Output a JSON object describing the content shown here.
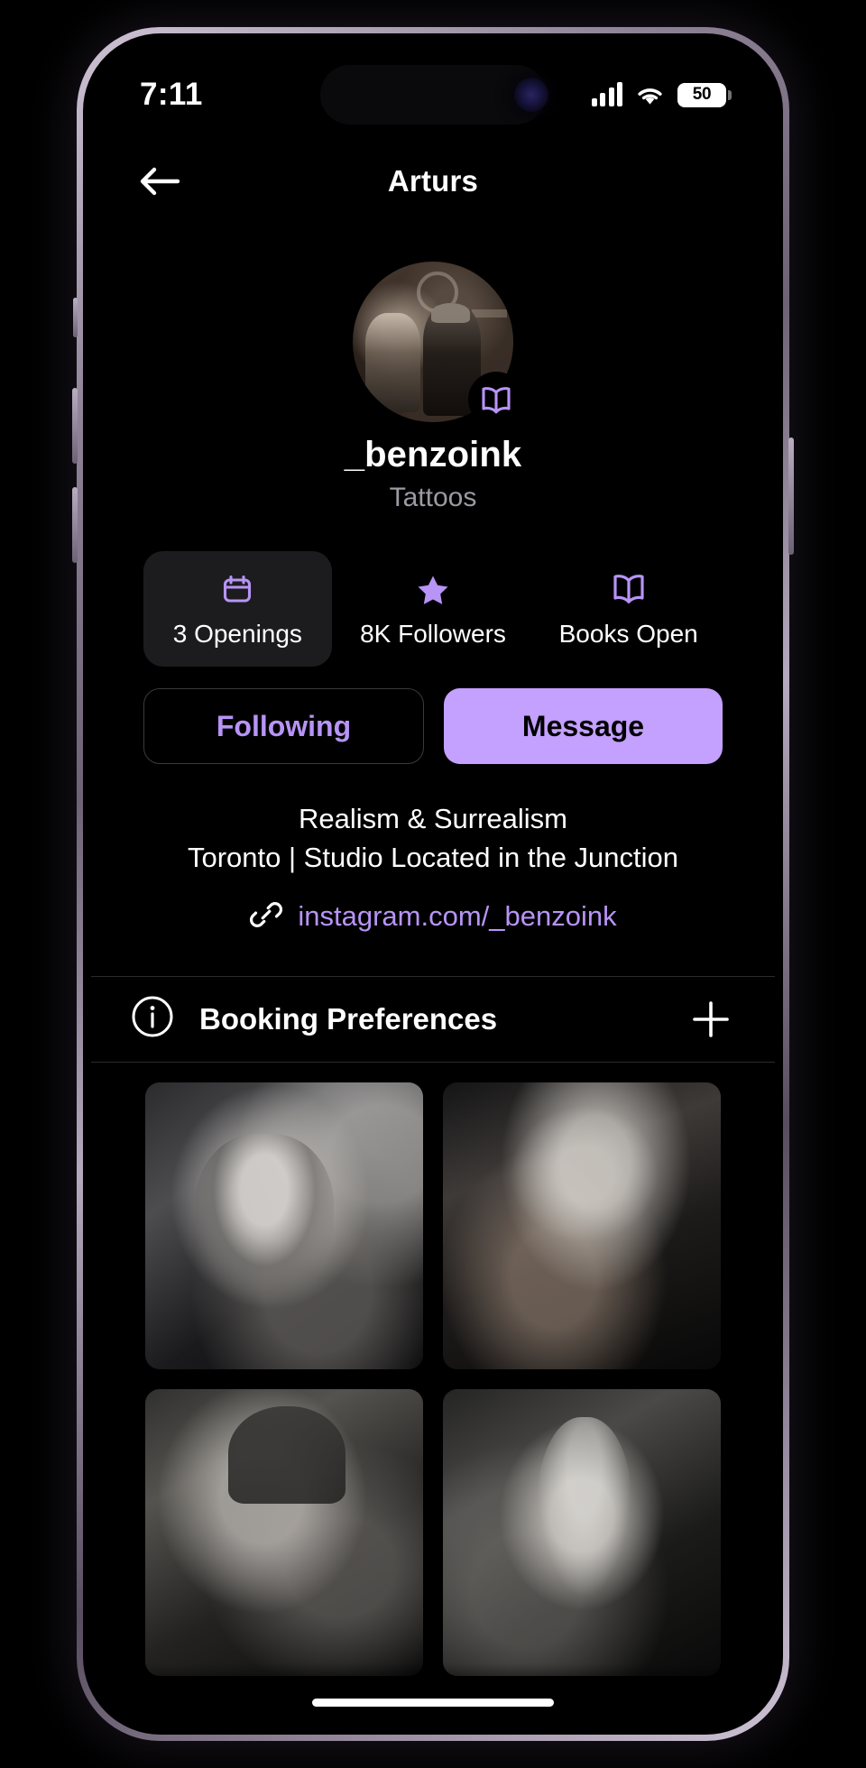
{
  "status_bar": {
    "time": "7:11",
    "battery_level": "50",
    "signal_icon": "cellular-signal-icon",
    "wifi_icon": "wifi-icon",
    "battery_icon": "battery-icon"
  },
  "nav": {
    "title": "Arturs",
    "back_icon": "arrow-left-icon"
  },
  "profile": {
    "name": "_benzoink",
    "subtitle": "Tattoos",
    "avatar_alt": "tattoo-artist-at-work-photo",
    "badge_icon": "open-book-icon"
  },
  "stats": [
    {
      "label": "3 Openings",
      "icon": "calendar-icon",
      "active": true
    },
    {
      "label": "8K Followers",
      "icon": "star-icon",
      "active": false
    },
    {
      "label": "Books Open",
      "icon": "open-book-icon",
      "active": false
    }
  ],
  "actions": {
    "following_label": "Following",
    "message_label": "Message"
  },
  "bio": {
    "line1": "Realism & Surrealism",
    "line2": "Toronto | Studio Located in the Junction",
    "link_text": "instagram.com/_benzoink",
    "link_icon": "link-chain-icon"
  },
  "booking": {
    "title": "Booking Preferences",
    "info_icon": "info-circle-icon",
    "add_icon": "plus-icon"
  },
  "gallery": [
    {
      "name": "viking-helmet-warrior-tattoo"
    },
    {
      "name": "wolf-forearm-tattoo"
    },
    {
      "name": "artist-portrait-photo"
    },
    {
      "name": "angel-statue-tattoo"
    }
  ],
  "colors": {
    "accent": "#b794f6",
    "accent_solid": "#c4a0ff",
    "background": "#000000",
    "card": "#1c1c1e",
    "muted_text": "#9b9ba3",
    "divider": "#2b2b2e"
  }
}
